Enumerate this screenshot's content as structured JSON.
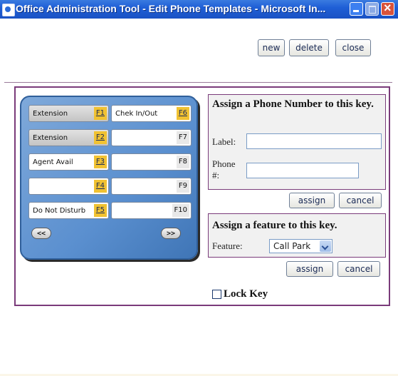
{
  "window": {
    "title": "Office Administration Tool - Edit Phone Templates - Microsoft In..."
  },
  "toolbar": {
    "new_label": "new",
    "delete_label": "delete",
    "close_label": "close"
  },
  "phone": {
    "left_keys": [
      {
        "label": "Extension",
        "code": "F1"
      },
      {
        "label": "Extension",
        "code": "F2"
      },
      {
        "label": "Agent Avail",
        "code": "F3"
      },
      {
        "label": "",
        "code": "F4"
      },
      {
        "label": "Do Not Disturb",
        "code": "F5"
      }
    ],
    "right_keys": [
      {
        "label": "Chek In/Out",
        "code": "F6"
      },
      {
        "label": "",
        "code": "F7"
      },
      {
        "label": "",
        "code": "F8"
      },
      {
        "label": "",
        "code": "F9"
      },
      {
        "label": "",
        "code": "F10"
      }
    ],
    "prev_label": "<<",
    "next_label": ">>"
  },
  "assign_number": {
    "title": "Assign a Phone Number to this key.",
    "label_field_label": "Label:",
    "label_value": "",
    "phone_field_label": "Phone #:",
    "phone_value": "",
    "assign_label": "assign",
    "cancel_label": "cancel"
  },
  "assign_feature": {
    "title": "Assign a feature to this key.",
    "feature_label": "Feature:",
    "selected": "Call Park",
    "assign_label": "assign",
    "cancel_label": "cancel"
  },
  "lock_key": {
    "label": "Lock Key",
    "checked": false
  },
  "colors": {
    "titlebar": "#1f5fd6",
    "panel_border": "#7a3b7a",
    "phone_body": "#5a8fcf",
    "key_code_highlight": "#f1c232"
  },
  "icons": [
    "ie-window-icon",
    "minimize-icon",
    "maximize-icon",
    "close-icon"
  ]
}
